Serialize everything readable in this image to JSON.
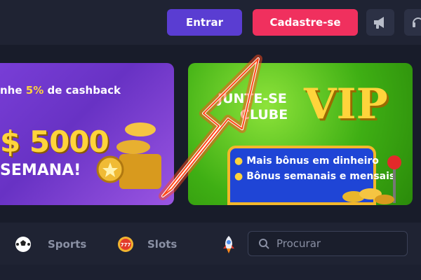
{
  "header": {
    "login_label": "Entrar",
    "signup_label": "Cadastre-se",
    "icons": [
      "megaphone-icon",
      "headset-icon"
    ]
  },
  "banners": {
    "cashback": {
      "line1_prefix": "nhe",
      "line1_percent": "5%",
      "line1_suffix": "de cashback",
      "amount": "$ 5000",
      "period": "SEMANA!"
    },
    "vip": {
      "join": "JUNTE-SE",
      "club": "CLUBE",
      "vip": "VIP",
      "benefits": [
        "Mais bônus em dinheiro",
        "Bônus semanais e mensais"
      ]
    }
  },
  "categories": [
    {
      "label": "Sports",
      "icon": "soccer-ball-icon"
    },
    {
      "label": "Slots",
      "icon": "slot-777-icon"
    },
    {
      "label": "",
      "icon": "rocket-icon"
    }
  ],
  "search": {
    "placeholder": "Procurar"
  },
  "colors": {
    "login": "#5a3dd2",
    "signup": "#f0305e",
    "background": "#1c2030",
    "highlight_arrow": "#ff4a1a"
  }
}
